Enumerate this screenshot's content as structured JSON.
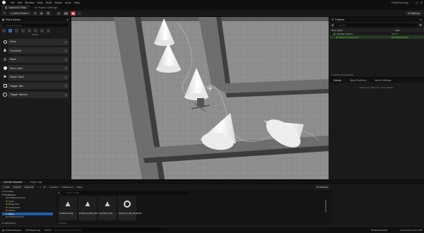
{
  "titlebar": {
    "menu": [
      "File",
      "Edit",
      "Window",
      "Tools",
      "Build",
      "Select",
      "Actor",
      "Help"
    ],
    "project_name": "FirstPersonCpp"
  },
  "tabs": [
    {
      "label": "LightsOut-Map"
    },
    {
      "label": "Project Settings"
    }
  ],
  "toolbar": {
    "mode_label": "Select Mode",
    "settings_label": "Settings"
  },
  "place_actors": {
    "title": "Place Actors",
    "search_placeholder": "Search Classes",
    "category_label": "BASIC",
    "items": [
      {
        "label": "Actor",
        "icon": "actor-icon"
      },
      {
        "label": "Character",
        "icon": "character-icon"
      },
      {
        "label": "Pawn",
        "icon": "pawn-icon"
      },
      {
        "label": "Point Light",
        "icon": "point-light-icon"
      },
      {
        "label": "Player Start",
        "icon": "player-start-icon"
      },
      {
        "label": "Trigger Box",
        "icon": "trigger-box-icon"
      },
      {
        "label": "Trigger Sphere",
        "icon": "trigger-sphere-icon"
      }
    ]
  },
  "outliner": {
    "title": "Outliner",
    "search_placeholder": "Search",
    "col_item": "Item Label",
    "col_type": "Type",
    "rows": [
      {
        "label": "MyMap (Editor)",
        "type": "World"
      },
      {
        "label": "Spline Component",
        "type": "StaticMeshActor"
      }
    ],
    "footer": "2 actors (1 selected)"
  },
  "details": {
    "tabs": [
      "Details",
      "World Partition",
      "World Settings"
    ],
    "empty_text": "Select an object to view details."
  },
  "content_browser": {
    "tabs": [
      "Content Browser",
      "Output Log"
    ],
    "add_label": "Add",
    "import_label": "Import",
    "save_label": "Save All",
    "path": [
      "All",
      "Content",
      "FirstPerson",
      "Maps"
    ],
    "settings_label": "Settings",
    "search_placeholder": "Search Maps",
    "favorites_label": "Favorites",
    "tree_root": "FirstPerson",
    "tree": [
      "FirstPerson",
      "FirstPersonArms",
      "Input",
      "Maps",
      "Blueprints",
      "Characters",
      "Levels",
      "StarterContent"
    ],
    "collections_label": "Collections",
    "item_count": "4 items",
    "assets": [
      {
        "name": "FirstPersonMap"
      },
      {
        "name": "FirstPersonMap_BuiltData"
      },
      {
        "name": "LightsOut_Map"
      },
      {
        "name": "LightsOut_Map_BuiltData"
      }
    ]
  },
  "statusbar": {
    "content_drawer": "Content Drawer",
    "output_log": "Output Log",
    "cmd_label": "Cmd",
    "console_placeholder": "Enter Console Command",
    "derived_data": "Derived Data",
    "source_control": "Source Control Off"
  },
  "colors": {
    "accent_green": "#6cd94a",
    "select_blue": "#1f5fa8"
  }
}
